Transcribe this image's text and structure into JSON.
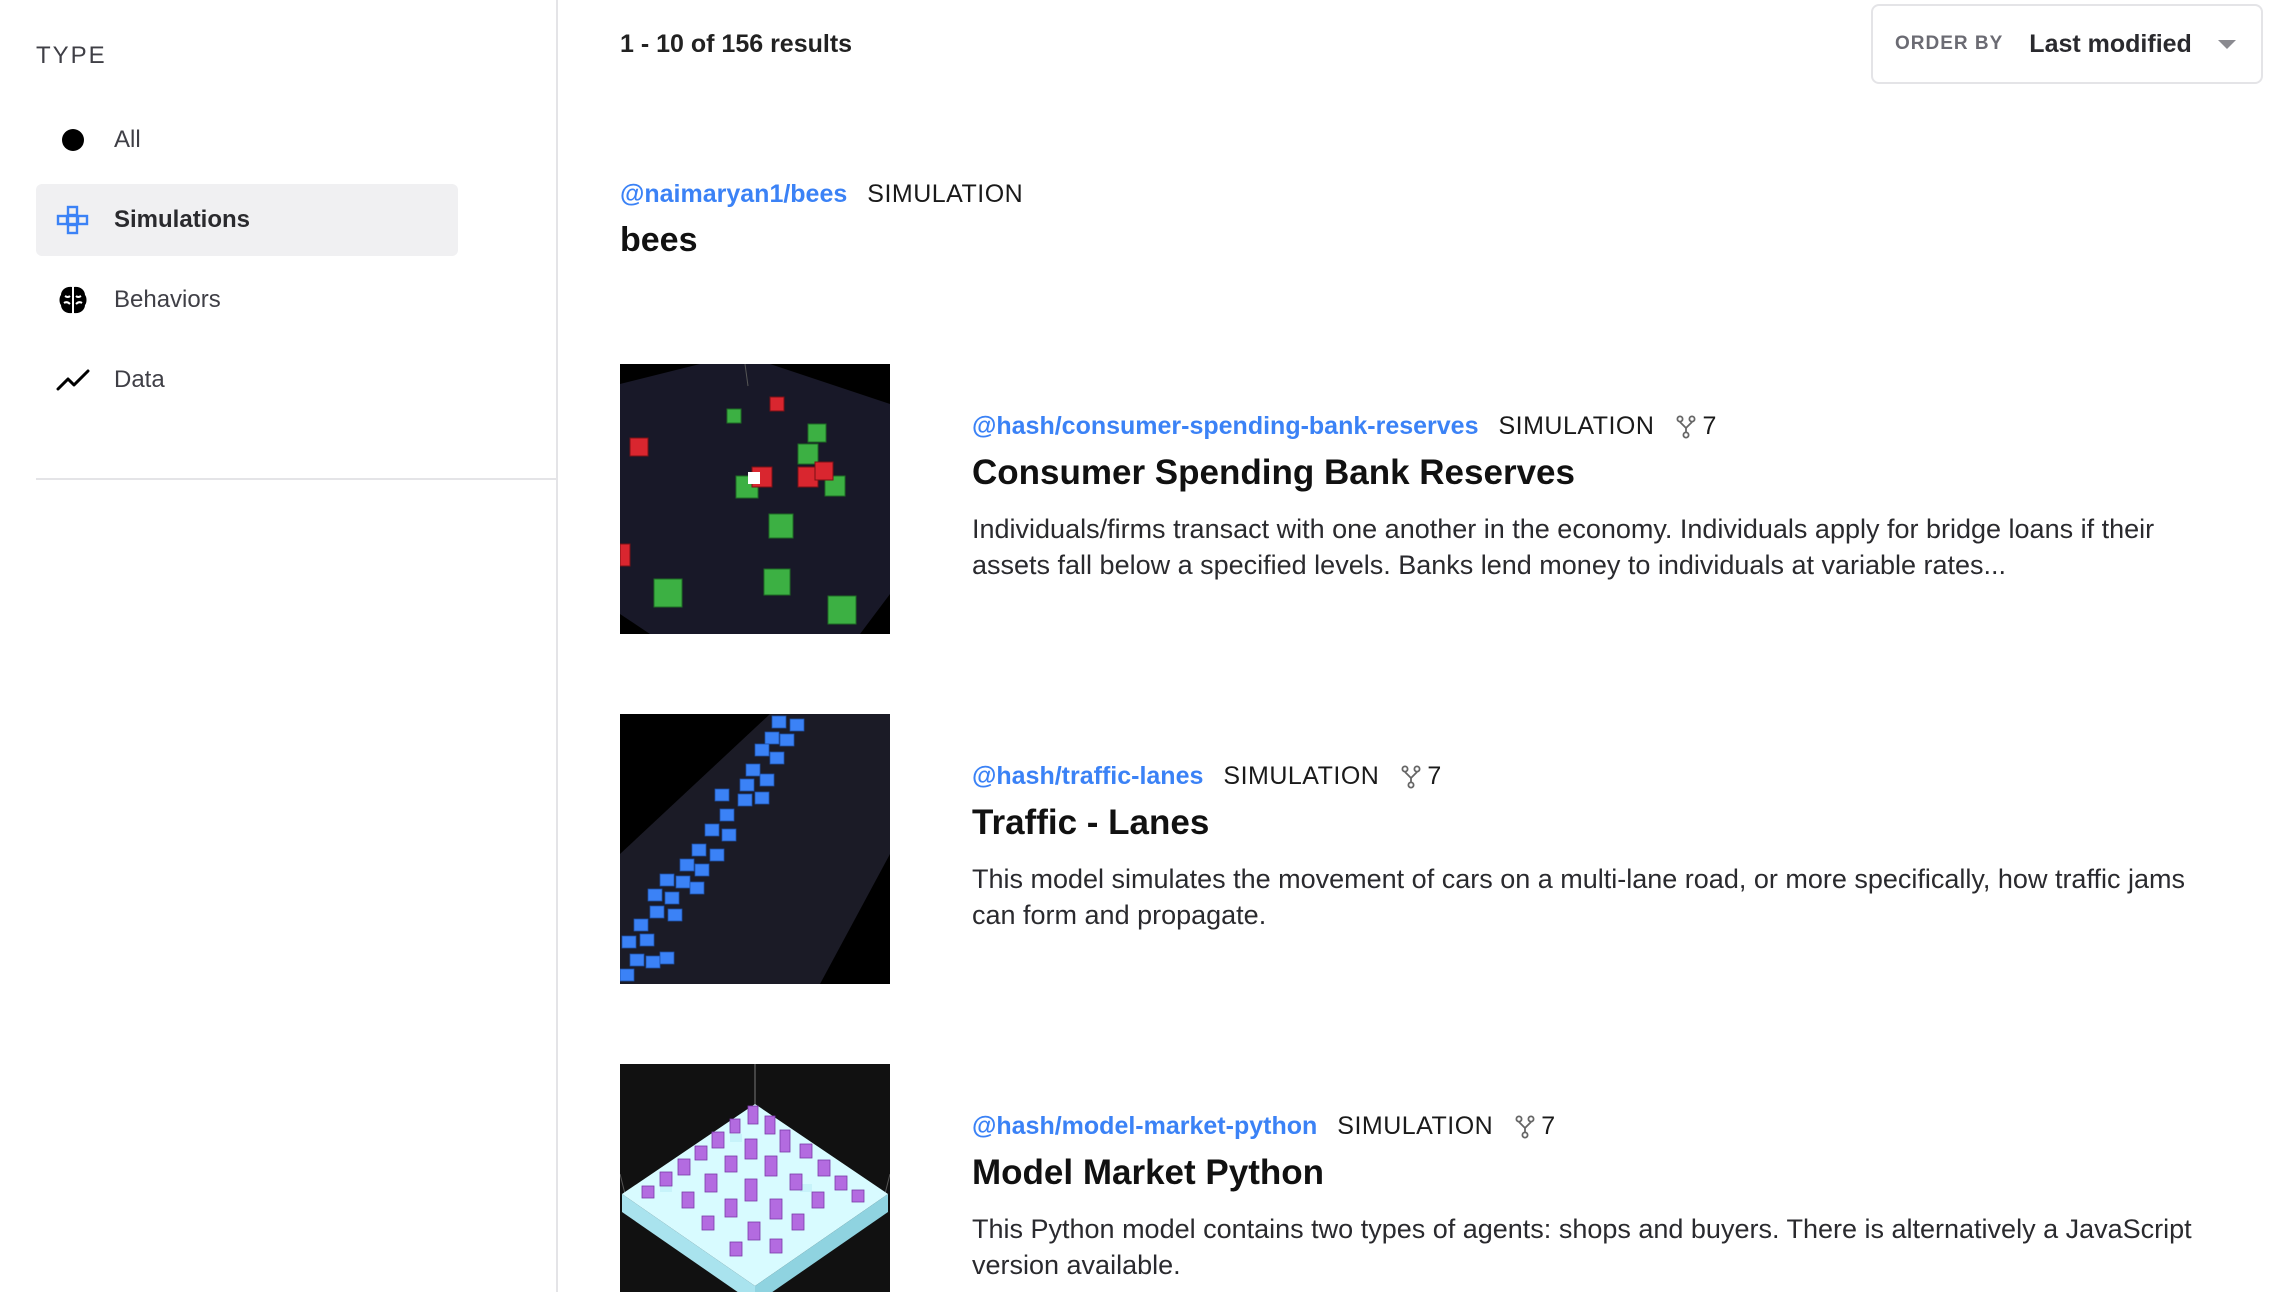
{
  "sidebar": {
    "heading": "TYPE",
    "items": [
      {
        "label": "All",
        "icon": "circle-icon"
      },
      {
        "label": "Simulations",
        "icon": "simulation-grid-icon",
        "active": true
      },
      {
        "label": "Behaviors",
        "icon": "brain-icon"
      },
      {
        "label": "Data",
        "icon": "trend-line-icon"
      }
    ]
  },
  "header": {
    "results_count": "1 - 10 of 156 results",
    "order_by_label": "ORDER BY",
    "order_by_value": "Last modified"
  },
  "results": [
    {
      "handle": "@naimaryan1/bees",
      "type": "SIMULATION",
      "title": "bees"
    },
    {
      "handle": "@hash/consumer-spending-bank-reserves",
      "type": "SIMULATION",
      "forks": "7",
      "title": "Consumer Spending Bank Reserves",
      "description": "Individuals/firms transact with one another in the economy. Individuals apply for bridge loans if their assets fall below a specified levels. Banks lend money to individuals at variable rates..."
    },
    {
      "handle": "@hash/traffic-lanes",
      "type": "SIMULATION",
      "forks": "7",
      "title": "Traffic - Lanes",
      "description": "This model simulates the movement of cars on a multi-lane road, or more specifically, how traffic jams can form and propagate."
    },
    {
      "handle": "@hash/model-market-python",
      "type": "SIMULATION",
      "forks": "7",
      "title": "Model Market Python",
      "description": "This Python model contains two types of agents: shops and buyers. There is alternatively a JavaScript version available."
    }
  ],
  "colors": {
    "link": "#3b82f6",
    "active_bg": "#f0f0f2",
    "accent_green": "#3cb043",
    "accent_red": "#d9262f",
    "accent_blue": "#3b82f6",
    "accent_purple": "#b36be0"
  }
}
